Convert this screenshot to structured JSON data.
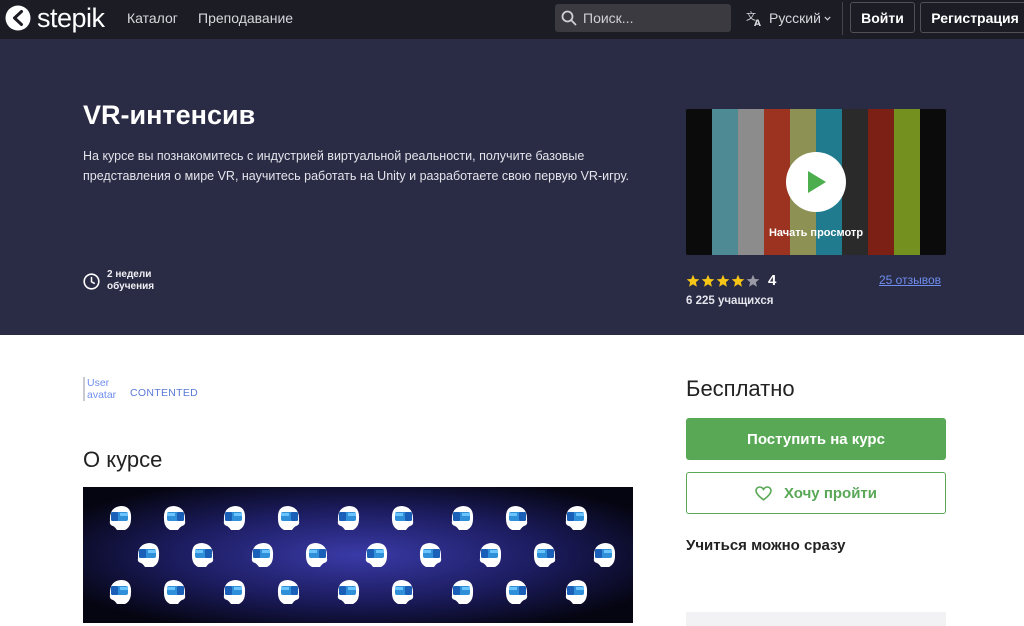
{
  "navbar": {
    "logo_text": "stepik",
    "links": {
      "catalog": "Каталог",
      "teaching": "Преподавание"
    },
    "search_placeholder": "Поиск...",
    "language": "Русский",
    "login_label": "Войти",
    "register_label": "Регистрация"
  },
  "hero": {
    "title": "VR-интенсив",
    "description": "На курсе вы познакомитесь с индустрией виртуальной реальности, получите базовые представления о мире VR, научитесь работать на Unity и разработаете свою первую VR-игру.",
    "duration": "2 недели обучения",
    "video_label": "Начать просмотр",
    "rating_value": "4",
    "rating_stars": 4,
    "rating_max": 5,
    "reviews_link": "25 отзывов",
    "learners": "6 225 учащихся"
  },
  "main": {
    "author_avatar_alt": "User avatar",
    "author_name": "CONTENTED",
    "about_heading": "О курсе"
  },
  "sidebar": {
    "price": "Бесплатно",
    "enroll_button": "Поступить на курс",
    "wishlist_button": "Хочу пройти",
    "start_info": "Учиться можно сразу"
  },
  "colors": {
    "navbar_bg": "#1c1c24",
    "hero_bg": "#2a2b44",
    "accent_green": "#59a856",
    "link_blue": "#6f8ef0",
    "star_yellow": "#f5c518",
    "video_bars": [
      "#0b0b0b",
      "#4e8a93",
      "#8c8c8c",
      "#9c3320",
      "#8d9153",
      "#1f7b8d",
      "#2b2a2a",
      "#7c1f14",
      "#74911f",
      "#0b0b0b"
    ]
  },
  "icons": {
    "logo": "stepik-logo-icon",
    "search": "search-icon",
    "language": "translate-icon",
    "chevron": "chevron-down-icon",
    "clock": "clock-icon",
    "play": "play-icon",
    "star": "star-icon",
    "heart": "heart-icon"
  }
}
